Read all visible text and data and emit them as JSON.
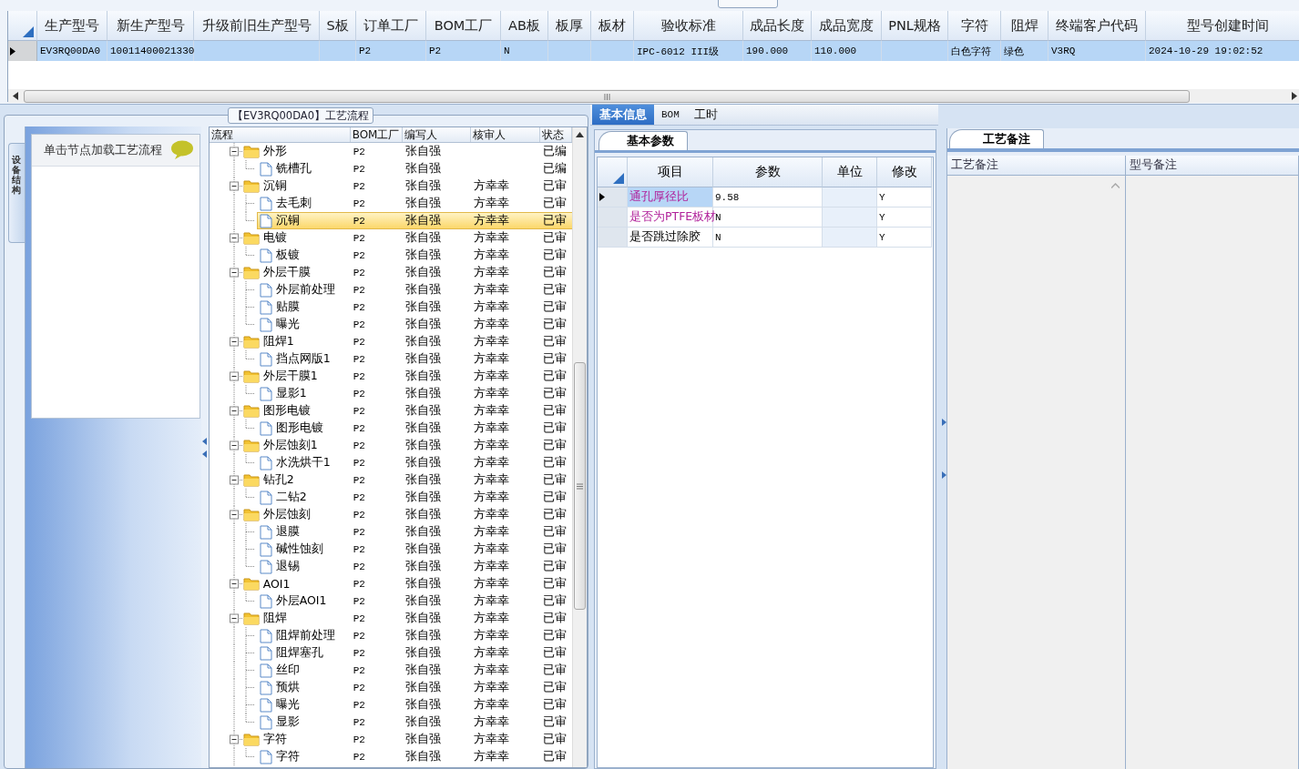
{
  "top_grid": {
    "columns": [
      "生产型号",
      "新生产型号",
      "升级前旧生产型号",
      "S板",
      "订单工厂",
      "BOM工厂",
      "AB板",
      "板厚",
      "板材",
      "验收标准",
      "成品长度",
      "成品宽度",
      "PNL规格",
      "字符",
      "阻焊",
      "终端客户代码",
      "型号创建时间"
    ],
    "rows": [
      {
        "selected": true,
        "cells": [
          "EV3RQ00DA0",
          "10011400021330",
          null,
          null,
          "P2",
          "P2",
          "N",
          null,
          null,
          "IPC-6012 III级",
          "190.000",
          "110.000",
          null,
          "白色字符",
          "绿色",
          "V3RQ",
          "2024-10-29 19:02:52"
        ]
      }
    ]
  },
  "flow_panel": {
    "title": "【EV3RQ00DA0】工艺流程",
    "side_tab": "设备结构",
    "hint": "单击节点加载工艺流程",
    "tree": {
      "columns": [
        "流程",
        "BOM工厂",
        "编写人",
        "核审人",
        "状态"
      ],
      "nodes": [
        {
          "name": "外形",
          "bom": "P2",
          "writer": "张自强",
          "status": "已编",
          "selected": false,
          "expanded": true,
          "children": [
            {
              "name": "铣槽孔",
              "bom": "P2",
              "writer": "张自强",
              "status": "已编",
              "selected": false
            }
          ]
        },
        {
          "name": "沉铜",
          "bom": "P2",
          "writer": "张自强",
          "reviewer": "方幸幸",
          "status": "已审",
          "selected": false,
          "expanded": true,
          "children": [
            {
              "name": "去毛刺",
              "bom": "P2",
              "writer": "张自强",
              "reviewer": "方幸幸",
              "status": "已审",
              "selected": false
            },
            {
              "name": "沉铜",
              "bom": "P2",
              "writer": "张自强",
              "reviewer": "方幸幸",
              "status": "已审",
              "selected": true
            }
          ]
        },
        {
          "name": "电镀",
          "bom": "P2",
          "writer": "张自强",
          "reviewer": "方幸幸",
          "status": "已审",
          "selected": false,
          "expanded": true,
          "children": [
            {
              "name": "板镀",
              "bom": "P2",
              "writer": "张自强",
              "reviewer": "方幸幸",
              "status": "已审",
              "selected": false
            }
          ]
        },
        {
          "name": "外层干膜",
          "bom": "P2",
          "writer": "张自强",
          "reviewer": "方幸幸",
          "status": "已审",
          "selected": false,
          "expanded": true,
          "children": [
            {
              "name": "外层前处理",
              "bom": "P2",
              "writer": "张自强",
              "reviewer": "方幸幸",
              "status": "已审",
              "selected": false
            },
            {
              "name": "贴膜",
              "bom": "P2",
              "writer": "张自强",
              "reviewer": "方幸幸",
              "status": "已审",
              "selected": false
            },
            {
              "name": "曝光",
              "bom": "P2",
              "writer": "张自强",
              "reviewer": "方幸幸",
              "status": "已审",
              "selected": false
            }
          ]
        },
        {
          "name": "阻焊1",
          "bom": "P2",
          "writer": "张自强",
          "reviewer": "方幸幸",
          "status": "已审",
          "selected": false,
          "expanded": true,
          "children": [
            {
              "name": "挡点网版1",
              "bom": "P2",
              "writer": "张自强",
              "reviewer": "方幸幸",
              "status": "已审",
              "selected": false
            }
          ]
        },
        {
          "name": "外层干膜1",
          "bom": "P2",
          "writer": "张自强",
          "reviewer": "方幸幸",
          "status": "已审",
          "selected": false,
          "expanded": true,
          "children": [
            {
              "name": "显影1",
              "bom": "P2",
              "writer": "张自强",
              "reviewer": "方幸幸",
              "status": "已审",
              "selected": false
            }
          ]
        },
        {
          "name": "图形电镀",
          "bom": "P2",
          "writer": "张自强",
          "reviewer": "方幸幸",
          "status": "已审",
          "selected": false,
          "expanded": true,
          "children": [
            {
              "name": "图形电镀",
              "bom": "P2",
              "writer": "张自强",
              "reviewer": "方幸幸",
              "status": "已审",
              "selected": false
            }
          ]
        },
        {
          "name": "外层蚀刻1",
          "bom": "P2",
          "writer": "张自强",
          "reviewer": "方幸幸",
          "status": "已审",
          "selected": false,
          "expanded": true,
          "children": [
            {
              "name": "水洗烘干1",
              "bom": "P2",
              "writer": "张自强",
              "reviewer": "方幸幸",
              "status": "已审",
              "selected": false
            }
          ]
        },
        {
          "name": "钻孔2",
          "bom": "P2",
          "writer": "张自强",
          "reviewer": "方幸幸",
          "status": "已审",
          "selected": false,
          "expanded": true,
          "children": [
            {
              "name": "二钻2",
              "bom": "P2",
              "writer": "张自强",
              "reviewer": "方幸幸",
              "status": "已审",
              "selected": false
            }
          ]
        },
        {
          "name": "外层蚀刻",
          "bom": "P2",
          "writer": "张自强",
          "reviewer": "方幸幸",
          "status": "已审",
          "selected": false,
          "expanded": true,
          "children": [
            {
              "name": "退膜",
              "bom": "P2",
              "writer": "张自强",
              "reviewer": "方幸幸",
              "status": "已审",
              "selected": false
            },
            {
              "name": "碱性蚀刻",
              "bom": "P2",
              "writer": "张自强",
              "reviewer": "方幸幸",
              "status": "已审",
              "selected": false
            },
            {
              "name": "退锡",
              "bom": "P2",
              "writer": "张自强",
              "reviewer": "方幸幸",
              "status": "已审",
              "selected": false
            }
          ]
        },
        {
          "name": "AOI1",
          "bom": "P2",
          "writer": "张自强",
          "reviewer": "方幸幸",
          "status": "已审",
          "selected": false,
          "expanded": true,
          "children": [
            {
              "name": "外层AOI1",
              "bom": "P2",
              "writer": "张自强",
              "reviewer": "方幸幸",
              "status": "已审",
              "selected": false
            }
          ]
        },
        {
          "name": "阻焊",
          "bom": "P2",
          "writer": "张自强",
          "reviewer": "方幸幸",
          "status": "已审",
          "selected": false,
          "expanded": true,
          "children": [
            {
              "name": "阻焊前处理",
              "bom": "P2",
              "writer": "张自强",
              "reviewer": "方幸幸",
              "status": "已审",
              "selected": false
            },
            {
              "name": "阻焊塞孔",
              "bom": "P2",
              "writer": "张自强",
              "reviewer": "方幸幸",
              "status": "已审",
              "selected": false
            },
            {
              "name": "丝印",
              "bom": "P2",
              "writer": "张自强",
              "reviewer": "方幸幸",
              "status": "已审",
              "selected": false
            },
            {
              "name": "预烘",
              "bom": "P2",
              "writer": "张自强",
              "reviewer": "方幸幸",
              "status": "已审",
              "selected": false
            },
            {
              "name": "曝光",
              "bom": "P2",
              "writer": "张自强",
              "reviewer": "方幸幸",
              "status": "已审",
              "selected": false
            },
            {
              "name": "显影",
              "bom": "P2",
              "writer": "张自强",
              "reviewer": "方幸幸",
              "status": "已审",
              "selected": false
            }
          ]
        },
        {
          "name": "字符",
          "bom": "P2",
          "writer": "张自强",
          "reviewer": "方幸幸",
          "status": "已审",
          "selected": false,
          "expanded": true,
          "children": [
            {
              "name": "字符",
              "bom": "P2",
              "writer": "张自强",
              "reviewer": "方幸幸",
              "status": "已审",
              "selected": false
            }
          ]
        }
      ]
    }
  },
  "detail": {
    "tabs": [
      {
        "label": "基本信息",
        "selected": true
      },
      {
        "label": "BOM",
        "selected": false
      },
      {
        "label": "工时",
        "selected": false
      }
    ],
    "params": {
      "tab": "基本参数",
      "columns": [
        "项目",
        "参数",
        "单位",
        "修改"
      ],
      "rows": [
        {
          "item": "通孔厚径比",
          "value": "9.58",
          "modify": "Y",
          "required": true,
          "selected": true
        },
        {
          "item": "是否为PTFE板材",
          "value": "N",
          "modify": "Y",
          "required": true,
          "selected": false
        },
        {
          "item": "是否跳过除胶",
          "value": "N",
          "modify": "Y",
          "required": false,
          "selected": false
        }
      ]
    }
  },
  "notes": {
    "tab": "工艺备注",
    "columns": [
      "工艺备注",
      "型号备注"
    ]
  }
}
